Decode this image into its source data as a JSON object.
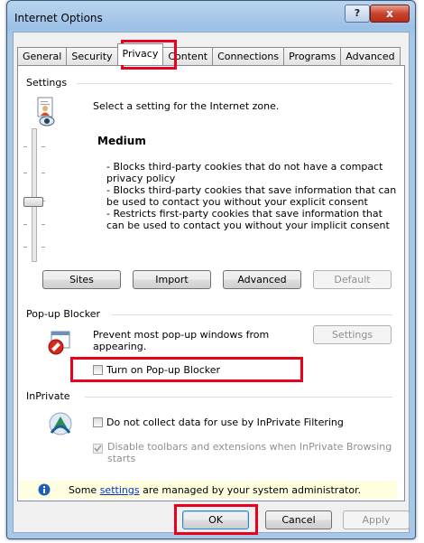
{
  "window": {
    "title": "Internet Options",
    "help_label": "?",
    "close_label": "x"
  },
  "tabs": [
    {
      "label": "General"
    },
    {
      "label": "Security"
    },
    {
      "label": "Privacy"
    },
    {
      "label": "Content"
    },
    {
      "label": "Connections"
    },
    {
      "label": "Programs"
    },
    {
      "label": "Advanced"
    }
  ],
  "settings": {
    "group_label": "Settings",
    "zone_text": "Select a setting for the Internet zone.",
    "level": "Medium",
    "description": [
      "- Blocks third-party cookies that do not have a compact",
      "privacy policy",
      "- Blocks third-party cookies that save information that can",
      "be used to contact you without your explicit consent",
      "- Restricts first-party cookies that save information that",
      "can be used to contact you without your implicit consent"
    ],
    "buttons": {
      "sites": "Sites",
      "import": "Import",
      "advanced": "Advanced",
      "default": "Default"
    }
  },
  "popup": {
    "group_label": "Pop-up Blocker",
    "text_line1": "Prevent most pop-up windows from",
    "text_line2": "appearing.",
    "settings_button": "Settings",
    "checkbox_label": "Turn on Pop-up Blocker",
    "checked": false
  },
  "inprivate": {
    "group_label": "InPrivate",
    "filter_label": "Do not collect data for use by InPrivate Filtering",
    "disable_line1": "Disable toolbars and extensions when InPrivate Browsing",
    "disable_line2": "starts"
  },
  "info": {
    "prefix": "Some ",
    "link": "settings",
    "suffix": " are managed by your system administrator."
  },
  "footer": {
    "ok": "OK",
    "cancel": "Cancel",
    "apply": "Apply"
  },
  "colors": {
    "highlight": "#e8001c",
    "info_bg": "#ffffe0",
    "link": "#0033cc"
  }
}
